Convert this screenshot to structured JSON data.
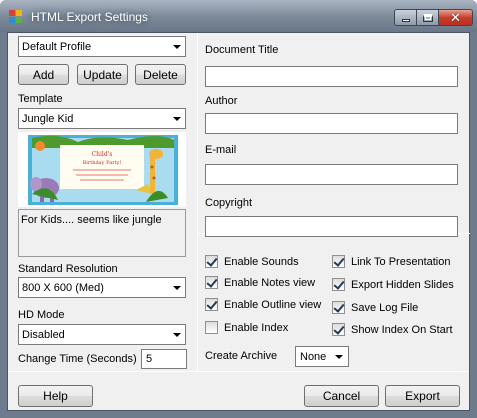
{
  "window": {
    "title": "HTML Export Settings",
    "close_glyph": "✕"
  },
  "profile": {
    "selected": "Default Profile",
    "add_label": "Add",
    "update_label": "Update",
    "delete_label": "Delete"
  },
  "template": {
    "label": "Template",
    "selected": "Jungle Kid",
    "description": "For Kids.... seems like jungle"
  },
  "resolution": {
    "label": "Standard Resolution",
    "selected": "800 X 600 (Med)"
  },
  "hd_mode": {
    "label": "HD Mode",
    "selected": "Disabled"
  },
  "change_time": {
    "label": "Change Time (Seconds)",
    "value": "5"
  },
  "fields": {
    "document_title_label": "Document Title",
    "document_title_value": "",
    "author_label": "Author",
    "author_value": "",
    "email_label": "E-mail",
    "email_value": "",
    "copyright_label": "Copyright",
    "copyright_value": ""
  },
  "options": {
    "left": [
      {
        "label": "Enable Sounds",
        "checked": true
      },
      {
        "label": "Enable Notes view",
        "checked": true
      },
      {
        "label": "Enable Outline view",
        "checked": true
      },
      {
        "label": "Enable Index",
        "checked": false
      }
    ],
    "right": [
      {
        "label": "Link To Presentation",
        "checked": true
      },
      {
        "label": "Export Hidden Slides",
        "checked": true
      },
      {
        "label": "Save Log File",
        "checked": true
      },
      {
        "label": "Show Index On Start",
        "checked": true
      }
    ]
  },
  "archive": {
    "label": "Create Archive",
    "selected": "None"
  },
  "footer": {
    "help_label": "Help",
    "cancel_label": "Cancel",
    "export_label": "Export"
  },
  "colors": {
    "title_bar": "#7b8898",
    "close_button": "#c7402d",
    "dialog_bg": "#f0f0f0"
  }
}
